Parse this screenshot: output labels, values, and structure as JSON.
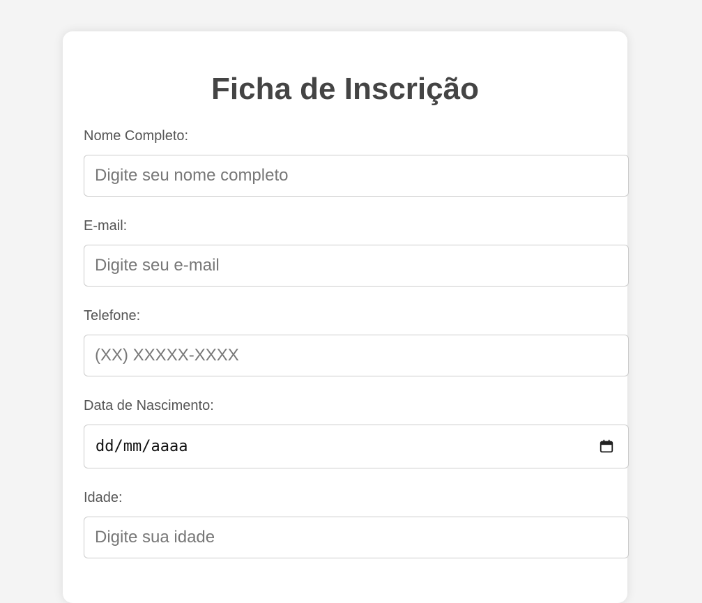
{
  "form": {
    "title": "Ficha de Inscrição",
    "fields": {
      "nome": {
        "label": "Nome Completo:",
        "placeholder": "Digite seu nome completo"
      },
      "email": {
        "label": "E-mail:",
        "placeholder": "Digite seu e-mail"
      },
      "telefone": {
        "label": "Telefone:",
        "placeholder": "(XX) XXXXX-XXXX"
      },
      "nascimento": {
        "label": "Data de Nascimento:",
        "value": "dd/mm/aaaa",
        "icon": "calendar-icon"
      },
      "idade": {
        "label": "Idade:",
        "placeholder": "Digite sua idade"
      }
    }
  },
  "colors": {
    "background": "#f4f4f4",
    "card": "#ffffff",
    "title": "#444444",
    "label": "#555555",
    "border": "#cccccc"
  }
}
